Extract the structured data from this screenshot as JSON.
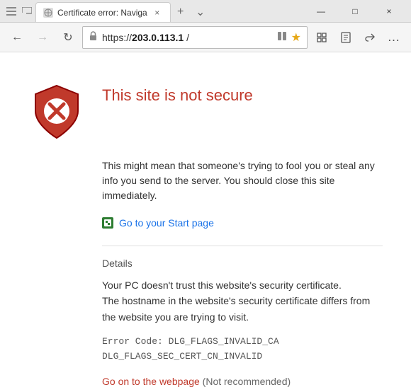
{
  "titlebar": {
    "tab": {
      "favicon": "🔒",
      "title": "Certificate error: Naviga",
      "close": "×"
    },
    "new_tab_label": "+",
    "tab_options_label": "⌄",
    "minimize": "—",
    "maximize": "□",
    "close": "×"
  },
  "navbar": {
    "back": "←",
    "forward": "→",
    "refresh": "↻",
    "lock_icon": "🔒",
    "address": "https://",
    "address_domain": "203.0.113.1",
    "address_suffix": " /",
    "reader": "☰",
    "favorite": "★",
    "favorites_icon": "✦",
    "notes_icon": "✏",
    "share_icon": "⎙",
    "more_icon": "…"
  },
  "page": {
    "error_title": "This site is not secure",
    "description": "This might mean that someone's trying to fool you or steal any info you send to the server. You should close this site immediately.",
    "start_page_label": "Go to your Start page",
    "details_heading": "Details",
    "details_text_1": "Your PC doesn't trust this website's security certificate.",
    "details_text_2": "The hostname in the website's security certificate differs from the website you are trying to visit.",
    "error_code_line1": "Error Code:  DLG_FLAGS_INVALID_CA",
    "error_code_line2": "DLG_FLAGS_SEC_CERT_CN_INVALID",
    "go_on_link": "Go on to the webpage",
    "not_recommended": " (Not recommended)"
  },
  "colors": {
    "error_red": "#c0392b",
    "link_blue": "#1a73e8",
    "shield_red": "#c0392b",
    "shield_dark_red": "#8b0000",
    "shield_bg": "#d32f2f"
  }
}
